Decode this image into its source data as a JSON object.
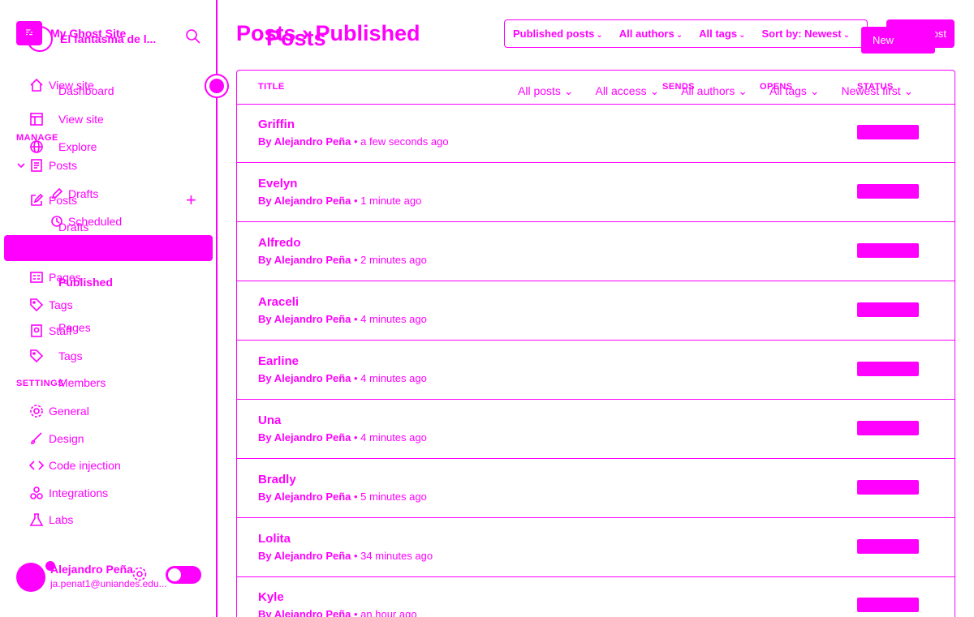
{
  "site": {
    "title": "My Ghost Site",
    "title_overlay": "El fantasma de l..."
  },
  "sidebar": {
    "top_links": [
      {
        "label": "View site",
        "icon": "home-icon"
      },
      {
        "label": "Dashboard",
        "icon": "home-icon"
      },
      {
        "label": "View site",
        "icon": "layout-icon"
      },
      {
        "label": "Explore",
        "icon": "globe-icon"
      }
    ],
    "manage_label": "MANAGE",
    "posts_label": "Posts",
    "posts_label_2": "Posts",
    "drafts_label": "Drafts",
    "drafts_label_2": "Drafts",
    "scheduled_label": "Scheduled",
    "published_label": "Published",
    "published_label_2": "Published",
    "pages_label": "Pages",
    "pages_label_2": "Pages",
    "tags_label": "Tags",
    "tags_label_2": "Tags",
    "staff_label": "Staff",
    "members_label": "Members",
    "settings_label": "SETTINGS",
    "general_label": "General",
    "design_label": "Design",
    "code_injection_label": "Code injection",
    "integrations_label": "Integrations",
    "labs_label": "Labs"
  },
  "user": {
    "name": "Alejandro Peña",
    "email": "ja.penat1@uniandes.edu..."
  },
  "header": {
    "heading": "Posts › Published",
    "heading_overlay": "Posts",
    "filters": [
      "Published posts",
      "All authors",
      "All tags",
      "Sort by: Newest"
    ],
    "new_post_label": "New post",
    "new_post_label_2": "New"
  },
  "list": {
    "columns": {
      "title": "TITLE",
      "sends": "SENDS",
      "opens": "OPENS",
      "status": "STATUS"
    },
    "sub_filters": [
      "All posts",
      "All access",
      "All authors",
      "All tags",
      "Newest first"
    ],
    "rows": [
      {
        "title": "Griffin",
        "author": "By Alejandro Peña",
        "time": "a few seconds ago"
      },
      {
        "title": "Evelyn",
        "author": "By Alejandro Peña",
        "time": "1 minute ago"
      },
      {
        "title": "Alfredo",
        "author": "By Alejandro Peña",
        "time": "2 minutes ago"
      },
      {
        "title": "Araceli",
        "author": "By Alejandro Peña",
        "time": "4 minutes ago"
      },
      {
        "title": "Earline",
        "author": "By Alejandro Peña",
        "time": "4 minutes ago"
      },
      {
        "title": "Una",
        "author": "By Alejandro Peña",
        "time": "4 minutes ago"
      },
      {
        "title": "Bradly",
        "author": "By Alejandro Peña",
        "time": "5 minutes ago"
      },
      {
        "title": "Lolita",
        "author": "By Alejandro Peña",
        "time": "34 minutes ago"
      },
      {
        "title": "Kyle",
        "author": "By Alejandro Peña",
        "time": "an hour ago"
      }
    ]
  },
  "colors": {
    "accent": "#ff00ff",
    "background": "#ffffff"
  }
}
